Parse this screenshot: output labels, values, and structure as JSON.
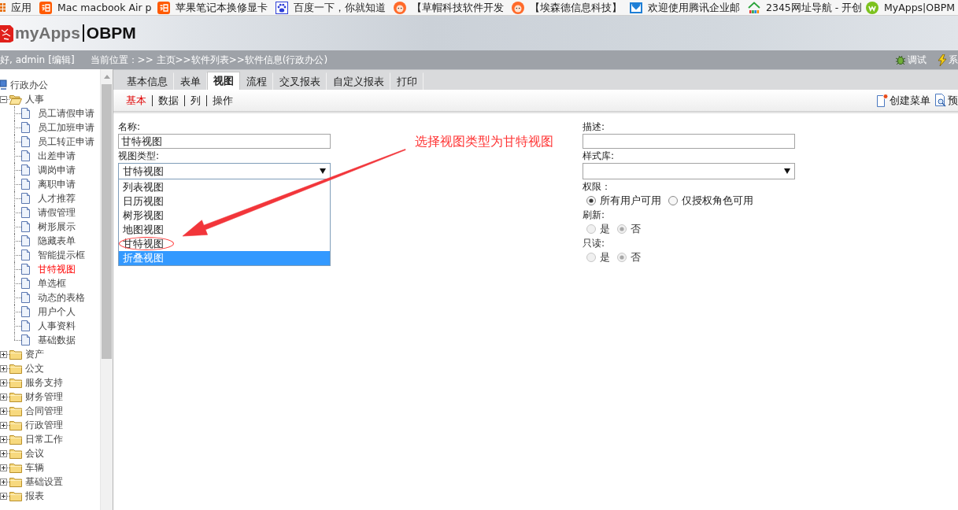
{
  "bookmarks_bar": {
    "items": [
      {
        "label": "应用",
        "kind": "apps"
      },
      {
        "label": "Mac macbook Air p",
        "kind": "shop"
      },
      {
        "label": "苹果笔记本换修显卡",
        "kind": "shop"
      },
      {
        "label": "百度一下，你就知道",
        "kind": "paw"
      },
      {
        "label": "【草帽科技软件开发",
        "kind": "face"
      },
      {
        "label": "【埃森德信息科技】",
        "kind": "face"
      },
      {
        "label": "欢迎使用腾讯企业邮",
        "kind": "mail"
      },
      {
        "label": "2345网址导航 - 开创",
        "kind": "house"
      },
      {
        "label": "MyApps|OBPM",
        "kind": "badge"
      }
    ]
  },
  "header": {
    "logo": "myApps",
    "product": "OBPM"
  },
  "status_bar": {
    "greeting": "好, admin",
    "edit_link": "[编辑]",
    "location": "当前位置：>> 主页>>软件列表>>软件信息(行政办公)",
    "actions": [
      {
        "label": "调试",
        "kind": "debug"
      },
      {
        "label": "系",
        "kind": "system"
      }
    ]
  },
  "sidebar": {
    "root": {
      "label": "行政办公",
      "children": [
        {
          "label": "人事",
          "kind": "folder",
          "expanded": true,
          "children": [
            {
              "label": "员工请假申请",
              "kind": "page",
              "selected": false
            },
            {
              "label": "员工加班申请",
              "kind": "page",
              "selected": false
            },
            {
              "label": "员工转正申请",
              "kind": "page",
              "selected": false
            },
            {
              "label": "出差申请",
              "kind": "page",
              "selected": false
            },
            {
              "label": "调岗申请",
              "kind": "page",
              "selected": false
            },
            {
              "label": "离职申请",
              "kind": "page",
              "selected": false
            },
            {
              "label": "人才推荐",
              "kind": "page",
              "selected": false
            },
            {
              "label": "请假管理",
              "kind": "page",
              "selected": false
            },
            {
              "label": "树形展示",
              "kind": "page",
              "selected": false
            },
            {
              "label": "隐藏表单",
              "kind": "page",
              "selected": false
            },
            {
              "label": "智能提示框",
              "kind": "page",
              "selected": false
            },
            {
              "label": "甘特视图",
              "kind": "page",
              "selected": true
            },
            {
              "label": "单选框",
              "kind": "page",
              "selected": false
            },
            {
              "label": "动态的表格",
              "kind": "page",
              "selected": false
            },
            {
              "label": "用户个人",
              "kind": "page",
              "selected": false
            },
            {
              "label": "人事资料",
              "kind": "page",
              "selected": false
            },
            {
              "label": "基础数据",
              "kind": "page",
              "selected": false
            }
          ]
        },
        {
          "label": "资产",
          "kind": "folder",
          "expanded": false
        },
        {
          "label": "公文",
          "kind": "folder",
          "expanded": false
        },
        {
          "label": "服务支持",
          "kind": "folder",
          "expanded": false
        },
        {
          "label": "财务管理",
          "kind": "folder",
          "expanded": false
        },
        {
          "label": "合同管理",
          "kind": "folder",
          "expanded": false
        },
        {
          "label": "行政管理",
          "kind": "folder",
          "expanded": false
        },
        {
          "label": "日常工作",
          "kind": "folder",
          "expanded": false
        },
        {
          "label": "会议",
          "kind": "folder",
          "expanded": false
        },
        {
          "label": "车辆",
          "kind": "folder",
          "expanded": false
        },
        {
          "label": "基础设置",
          "kind": "folder",
          "expanded": false
        },
        {
          "label": "报表",
          "kind": "folder",
          "expanded": false
        }
      ]
    }
  },
  "tabs": [
    {
      "label": "基本信息",
      "selected": false
    },
    {
      "label": "表单",
      "selected": false
    },
    {
      "label": "视图",
      "selected": true
    },
    {
      "label": "流程",
      "selected": false
    },
    {
      "label": "交叉报表",
      "selected": false
    },
    {
      "label": "自定义报表",
      "selected": false
    },
    {
      "label": "打印",
      "selected": false
    }
  ],
  "sub_tabs": [
    {
      "label": "基本",
      "selected": true
    },
    {
      "label": "数据",
      "selected": false
    },
    {
      "label": "列",
      "selected": false
    },
    {
      "label": "操作",
      "selected": false
    }
  ],
  "toolbar_actions": [
    {
      "label": "创建菜单",
      "kind": "create"
    },
    {
      "label": "预",
      "kind": "preview"
    }
  ],
  "form": {
    "left_column": {
      "fields": [
        {
          "kind": "text",
          "label": "名称:",
          "value": "甘特视图"
        },
        {
          "kind": "select",
          "label": "视图类型:",
          "value": "甘特视图",
          "expanded": true,
          "options": [
            {
              "label": "列表视图",
              "highlighted": false,
              "circled": false
            },
            {
              "label": "日历视图",
              "highlighted": false,
              "circled": false
            },
            {
              "label": "树形视图",
              "highlighted": false,
              "circled": false
            },
            {
              "label": "地图视图",
              "highlighted": false,
              "circled": false
            },
            {
              "label": "甘特视图",
              "highlighted": false,
              "circled": true
            },
            {
              "label": "折叠视图",
              "highlighted": true,
              "circled": false
            }
          ]
        }
      ]
    },
    "right_column": {
      "fields": [
        {
          "kind": "text",
          "label": "描述:"
        },
        {
          "kind": "select",
          "label": "样式库:",
          "expanded": false
        },
        {
          "kind": "radio",
          "label": "权限：",
          "disabled": false,
          "options": [
            {
              "label": "所有用户可用",
              "selected": true
            },
            {
              "label": "仅授权角色可用",
              "selected": false
            }
          ]
        },
        {
          "kind": "radio",
          "label": "刷新:",
          "disabled": true,
          "options": [
            {
              "label": "是",
              "selected": false
            },
            {
              "label": "否",
              "selected": true
            }
          ]
        },
        {
          "kind": "radio",
          "label": "只读:",
          "disabled": true,
          "options": [
            {
              "label": "是",
              "selected": false
            },
            {
              "label": "否",
              "selected": true
            }
          ]
        }
      ]
    }
  },
  "annotation": {
    "text": "选择视图类型为甘特视图"
  }
}
